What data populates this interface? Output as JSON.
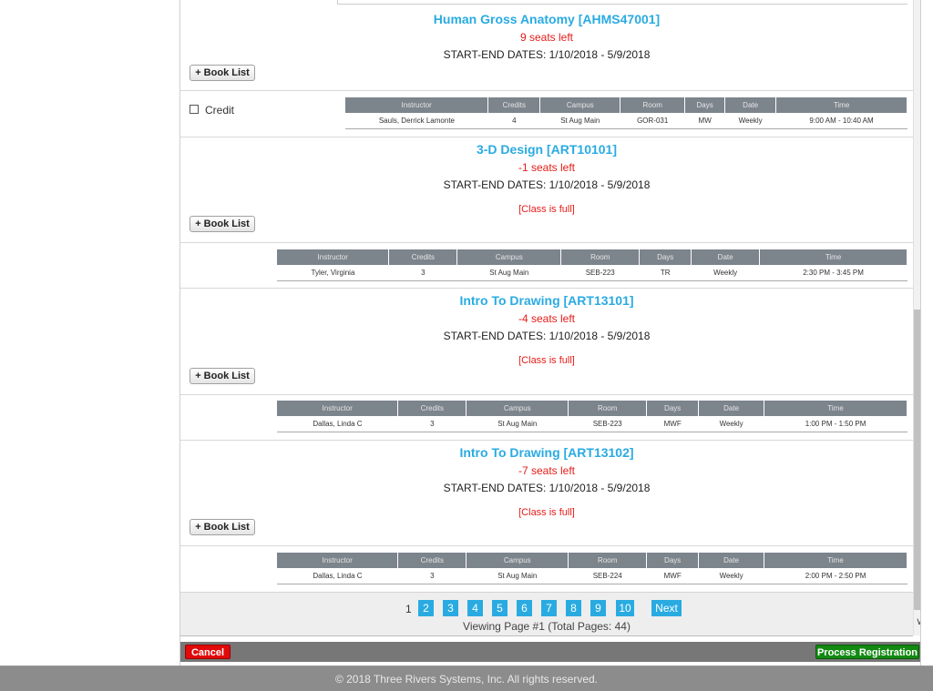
{
  "courses": [
    {
      "title": "Human Gross Anatomy [AHMS47001]",
      "seats": "9 seats left",
      "dates": "START-END DATES: 1/10/2018 - 5/9/2018",
      "full": "",
      "booklist": "+ Book List",
      "credit_label": "Credit",
      "schedule": {
        "headers": [
          "Instructor",
          "Credits",
          "Campus",
          "Room",
          "Days",
          "Date",
          "Time"
        ],
        "row": [
          "Sauls, Derrick Lamonte",
          "4",
          "St Aug Main",
          "GOR-031",
          "MW",
          "Weekly",
          "9:00 AM - 10:40 AM"
        ]
      }
    },
    {
      "title": "3-D Design [ART10101]",
      "seats": "-1 seats left",
      "dates": "START-END DATES: 1/10/2018 - 5/9/2018",
      "full": "[Class is full]",
      "booklist": "+ Book List",
      "schedule": {
        "headers": [
          "Instructor",
          "Credits",
          "Campus",
          "Room",
          "Days",
          "Date",
          "Time"
        ],
        "row": [
          "Tyler, Virginia",
          "3",
          "St Aug Main",
          "SEB-223",
          "TR",
          "Weekly",
          "2:30 PM - 3:45 PM"
        ]
      }
    },
    {
      "title": "Intro To Drawing [ART13101]",
      "seats": "-4 seats left",
      "dates": "START-END DATES: 1/10/2018 - 5/9/2018",
      "full": "[Class is full]",
      "booklist": "+ Book List",
      "schedule": {
        "headers": [
          "Instructor",
          "Credits",
          "Campus",
          "Room",
          "Days",
          "Date",
          "Time"
        ],
        "row": [
          "Dallas, Linda C",
          "3",
          "St Aug Main",
          "SEB-223",
          "MWF",
          "Weekly",
          "1:00 PM - 1:50 PM"
        ]
      }
    },
    {
      "title": "Intro To Drawing [ART13102]",
      "seats": "-7 seats left",
      "dates": "START-END DATES: 1/10/2018 - 5/9/2018",
      "full": "[Class is full]",
      "booklist": "+ Book List",
      "schedule": {
        "headers": [
          "Instructor",
          "Credits",
          "Campus",
          "Room",
          "Days",
          "Date",
          "Time"
        ],
        "row": [
          "Dallas, Linda C",
          "3",
          "St Aug Main",
          "SEB-224",
          "MWF",
          "Weekly",
          "2:00 PM - 2:50 PM"
        ]
      }
    }
  ],
  "pagination": {
    "current": "1",
    "pages": [
      "2",
      "3",
      "4",
      "5",
      "6",
      "7",
      "8",
      "9",
      "10"
    ],
    "next": "Next",
    "info": "Viewing Page #1 (Total Pages: 44)"
  },
  "actions": {
    "cancel": "Cancel",
    "process": "Process Registration"
  },
  "footer": {
    "text": "© 2018 Three Rivers Systems, Inc. All rights reserved."
  },
  "colors": {
    "course_title": "#29abe2",
    "seats_warning": "#e41b17",
    "table_header": "#7c848c",
    "page_button": "#29abe2",
    "cancel": "#e10a0a",
    "process": "#128a12"
  },
  "icons": {
    "scroll_down": "chevron-down-icon"
  }
}
